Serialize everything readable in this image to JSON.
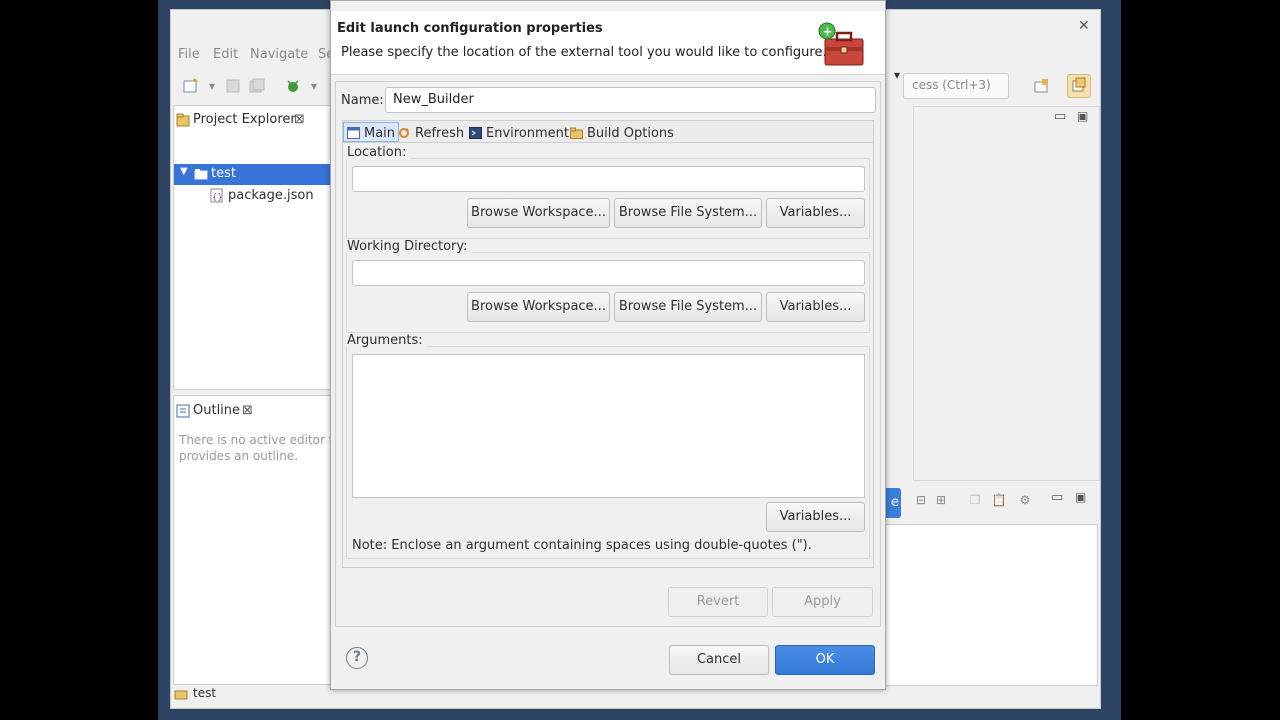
{
  "ide": {
    "menu": [
      "File",
      "Edit",
      "Navigate",
      "Se"
    ],
    "quick_access": "cess (Ctrl+3)",
    "project_explorer": {
      "tab_label": "Project Explorer",
      "tree": [
        {
          "label": "test",
          "icon": "folder-icon",
          "selected": true
        },
        {
          "label": "package.json",
          "icon": "json-file-icon",
          "selected": false
        }
      ]
    },
    "outline": {
      "tab_label": "Outline",
      "message_line1": "There is no active editor t",
      "message_line2": "provides an outline."
    },
    "status": {
      "label": "test"
    },
    "partial_button": "e"
  },
  "dialog": {
    "title": "Edit launch configuration properties",
    "description": "Please specify the location of the external tool you would like to configure.",
    "name_label": "Name:",
    "name_value": "New_Builder",
    "tabs": [
      {
        "label": "Main",
        "icon": "main-tab-icon",
        "active": true
      },
      {
        "label": "Refresh",
        "icon": "refresh-icon",
        "active": false
      },
      {
        "label": "Environment",
        "icon": "environment-icon",
        "active": false
      },
      {
        "label": "Build Options",
        "icon": "build-options-icon",
        "active": false
      }
    ],
    "location": {
      "label": "Location:",
      "value": "",
      "browse_workspace": "Browse Workspace...",
      "browse_file_system": "Browse File System...",
      "variables": "Variables..."
    },
    "working_directory": {
      "label": "Working Directory:",
      "value": "",
      "browse_workspace": "Browse Workspace...",
      "browse_file_system": "Browse File System...",
      "variables": "Variables..."
    },
    "arguments": {
      "label": "Arguments:",
      "value": "",
      "variables": "Variables...",
      "note": "Note: Enclose an argument containing spaces using double-quotes (\")."
    },
    "revert_label": "Revert",
    "apply_label": "Apply",
    "cancel_label": "Cancel",
    "ok_label": "OK",
    "help_symbol": "?"
  },
  "colors": {
    "accent": "#3874d8",
    "primary_button": "#3a7fdc",
    "dialog_bg": "#f0f0f0",
    "desktop_bg": "#2d4462"
  }
}
